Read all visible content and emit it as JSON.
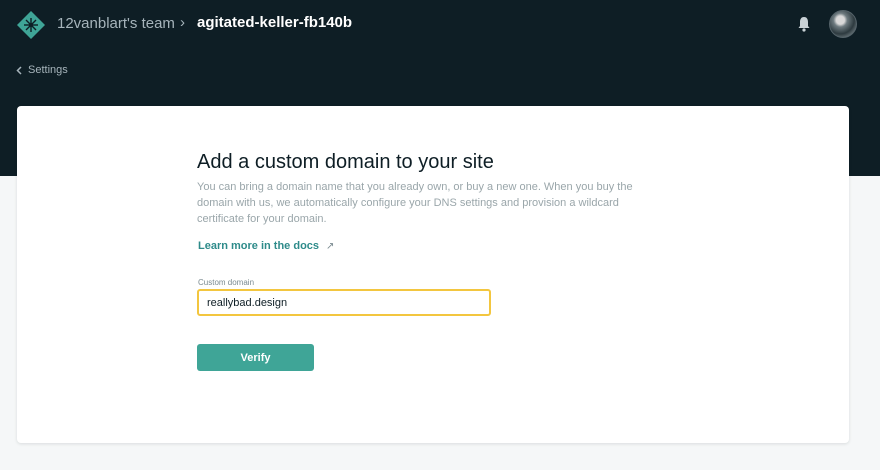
{
  "header": {
    "team_name": "12vanblart's team",
    "breadcrumb_separator": "›",
    "site_name": "agitated-keller-fb140b"
  },
  "back_link": {
    "label": "Settings"
  },
  "main": {
    "title": "Add a custom domain to your site",
    "description": "You can bring a domain name that you already own, or buy a new one. When you buy the domain with us, we automatically configure your DNS settings and provision a wildcard certificate for your domain.",
    "docs_link": "Learn more in the docs",
    "docs_link_icon": "↗",
    "field_label": "Custom domain",
    "field_value": "reallybad.design",
    "verify_label": "Verify"
  },
  "colors": {
    "header_bg": "#0e1e25",
    "accent": "#3fa597",
    "field_focus": "#f3c63f"
  },
  "icons": [
    "netlify-logo-icon",
    "bell-icon",
    "avatar",
    "chevron-left-icon",
    "external-link-icon"
  ]
}
